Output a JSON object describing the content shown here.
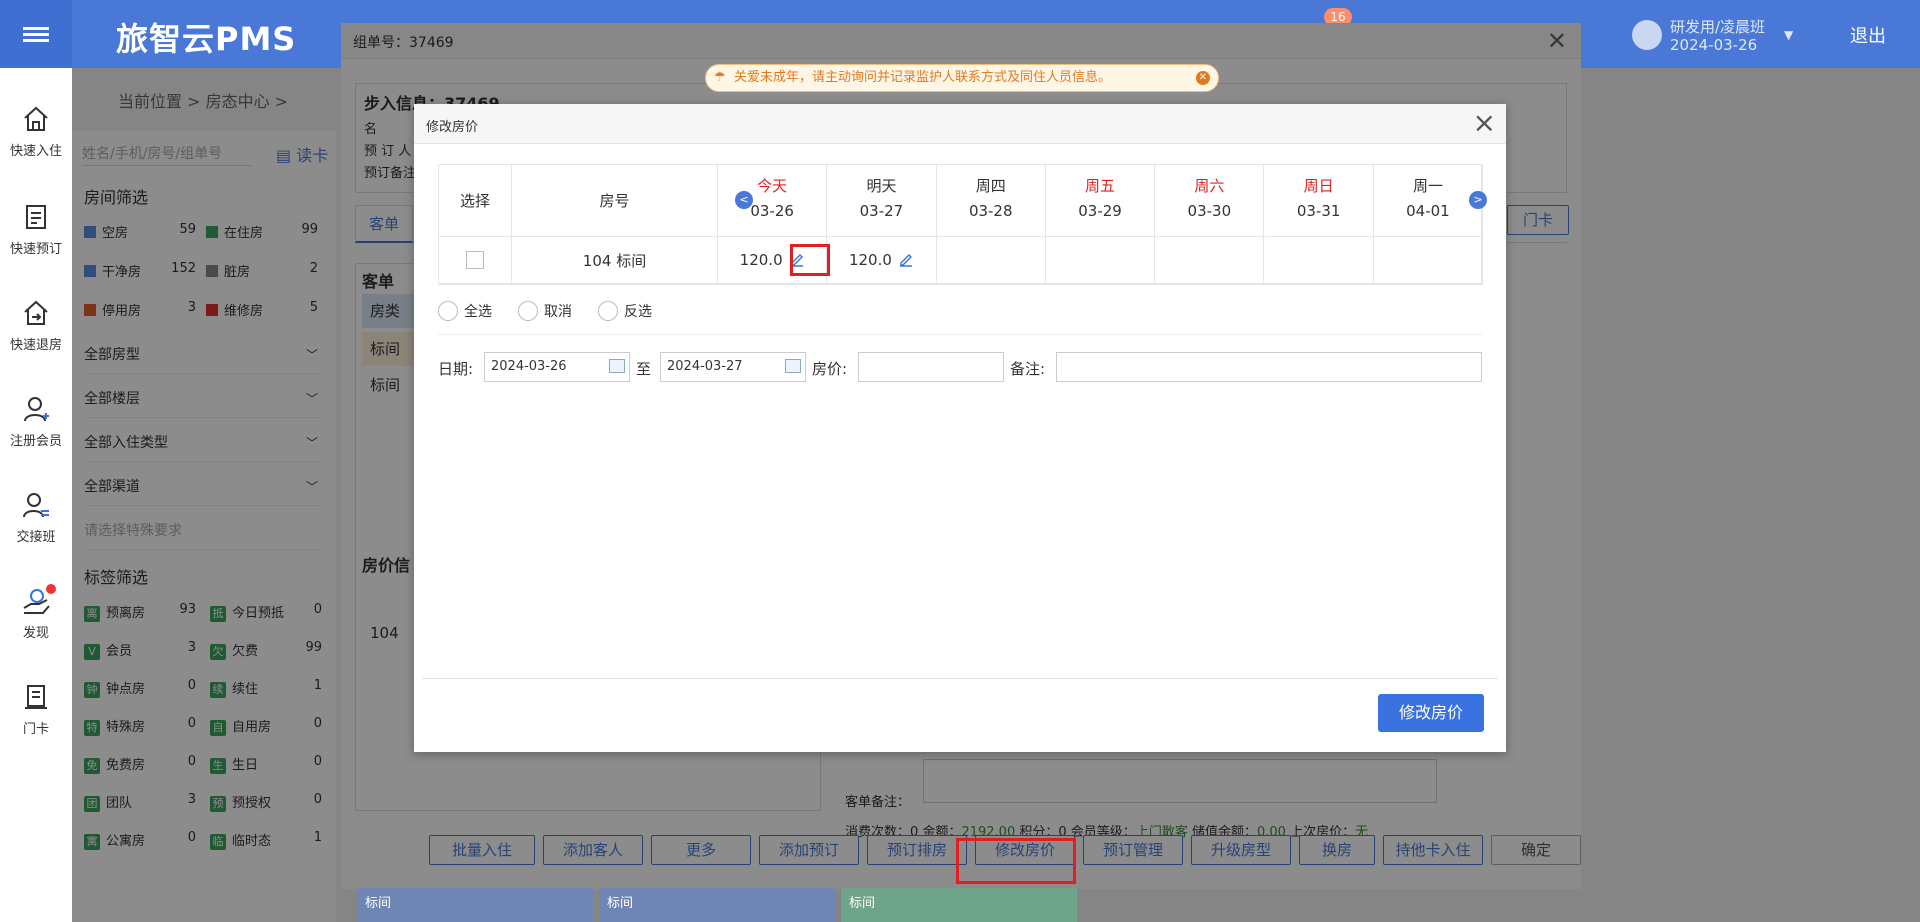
{
  "app": {
    "logo": "旅智云PMS",
    "user_name": "研发用/凌晨班",
    "user_date": "2024-03-26",
    "logout": "退出",
    "notification_count": "16"
  },
  "leftnav": [
    {
      "label": "快速入住"
    },
    {
      "label": "快速预订"
    },
    {
      "label": "快速退房"
    },
    {
      "label": "注册会员"
    },
    {
      "label": "交接班"
    },
    {
      "label": "发现"
    },
    {
      "label": "门卡"
    }
  ],
  "breadcrumb": "当前位置  >  房态中心  >",
  "sidebar": {
    "search_placeholder": "姓名/手机/房号/组单号",
    "read_card": "读卡",
    "room_filter_title": "房间筛选",
    "room_status": [
      {
        "label": "空房",
        "count": "59",
        "color": "#5b8de0"
      },
      {
        "label": "在住房",
        "count": "99",
        "color": "#3ba55c"
      },
      {
        "label": "干净房",
        "count": "152",
        "color": "#5b8de0"
      },
      {
        "label": "脏房",
        "count": "2",
        "color": "#888888"
      },
      {
        "label": "停用房",
        "count": "3",
        "color": "#e06030"
      },
      {
        "label": "维修房",
        "count": "5",
        "color": "#e03030"
      }
    ],
    "dropdowns": [
      "全部房型",
      "全部楼层",
      "全部入住类型",
      "全部渠道"
    ],
    "special_placeholder": "请选择特殊要求",
    "tag_filter_title": "标签筛选",
    "tags": [
      {
        "icon": "离",
        "label": "预离房",
        "count": "93"
      },
      {
        "icon": "抵",
        "label": "今日预抵",
        "count": "0"
      },
      {
        "icon": "V",
        "label": "会员",
        "count": "3"
      },
      {
        "icon": "欠",
        "label": "欠费",
        "count": "99"
      },
      {
        "icon": "钟",
        "label": "钟点房",
        "count": "0"
      },
      {
        "icon": "续",
        "label": "续住",
        "count": "1"
      },
      {
        "icon": "特",
        "label": "特殊房",
        "count": "0"
      },
      {
        "icon": "自",
        "label": "自用房",
        "count": "0"
      },
      {
        "icon": "免",
        "label": "免费房",
        "count": "0"
      },
      {
        "icon": "生",
        "label": "生日",
        "count": "0"
      },
      {
        "icon": "团",
        "label": "团队",
        "count": "3"
      },
      {
        "icon": "预",
        "label": "预授权",
        "count": "0"
      },
      {
        "icon": "寓",
        "label": "公寓房",
        "count": "0"
      },
      {
        "icon": "临",
        "label": "临时态",
        "count": "1"
      }
    ]
  },
  "group_dialog": {
    "title": "组单号：37469",
    "section_title": "步入信息：37469",
    "labels": {
      "name": "名",
      "booking": "预 订 人",
      "remark": "预订备注"
    },
    "tab_active": "客单",
    "menka_button": "门卡",
    "left_panel_title": "客单",
    "left_panel_rows": [
      "房类",
      "标间",
      "标间"
    ],
    "price_info_title": "房价信",
    "price_info_room": "104",
    "remark_label": "客单备注：",
    "stats": {
      "times_label": "消费次数：",
      "times": "0",
      "amount_label": "金额：",
      "amount": "2192.00",
      "points_label": "积分：",
      "points": "0",
      "level_label": "会员等级：",
      "level": "上门散客",
      "balance_label": "储值余额：",
      "balance": "0.00",
      "last_price_label": "上次房价：",
      "last_price": "无"
    },
    "footer_buttons": [
      {
        "label": "批量入住",
        "w": 106
      },
      {
        "label": "添加客人",
        "w": 100
      },
      {
        "label": "更多",
        "w": 100
      },
      {
        "label": "添加预订",
        "w": 100
      },
      {
        "label": "预订排房",
        "w": 100
      },
      {
        "label": "修改房价",
        "w": 100
      },
      {
        "label": "预订管理",
        "w": 100
      },
      {
        "label": "升级房型",
        "w": 100
      },
      {
        "label": "换房",
        "w": 76
      },
      {
        "label": "持他卡入住",
        "w": 100
      },
      {
        "label": "确定",
        "w": 90
      }
    ]
  },
  "notice": "关爱未成年，请主动询问并记录监护人联系方式及同住人员信息。",
  "bottom_rooms": [
    "标间",
    "标间",
    "标间"
  ],
  "price_dialog": {
    "title": "修改房价",
    "col_select": "选择",
    "col_room": "房号",
    "days": [
      {
        "name": "今天",
        "date": "03-26",
        "red": true
      },
      {
        "name": "明天",
        "date": "03-27",
        "red": false
      },
      {
        "name": "周四",
        "date": "03-28",
        "red": false
      },
      {
        "name": "周五",
        "date": "03-29",
        "red": true
      },
      {
        "name": "周六",
        "date": "03-30",
        "red": true
      },
      {
        "name": "周日",
        "date": "03-31",
        "red": true
      },
      {
        "name": "周一",
        "date": "04-01",
        "red": false
      }
    ],
    "row": {
      "room": "104 标间",
      "prices": [
        "120.0",
        "120.0",
        "",
        "",
        "",
        "",
        ""
      ]
    },
    "radios": [
      "全选",
      "取消",
      "反选"
    ],
    "form": {
      "date_label": "日期:",
      "date_from": "2024-03-26",
      "to_label": "至",
      "date_to": "2024-03-27",
      "price_label": "房价:",
      "price_value": "",
      "remark_label": "备注:",
      "remark_value": ""
    },
    "submit": "修改房价"
  }
}
